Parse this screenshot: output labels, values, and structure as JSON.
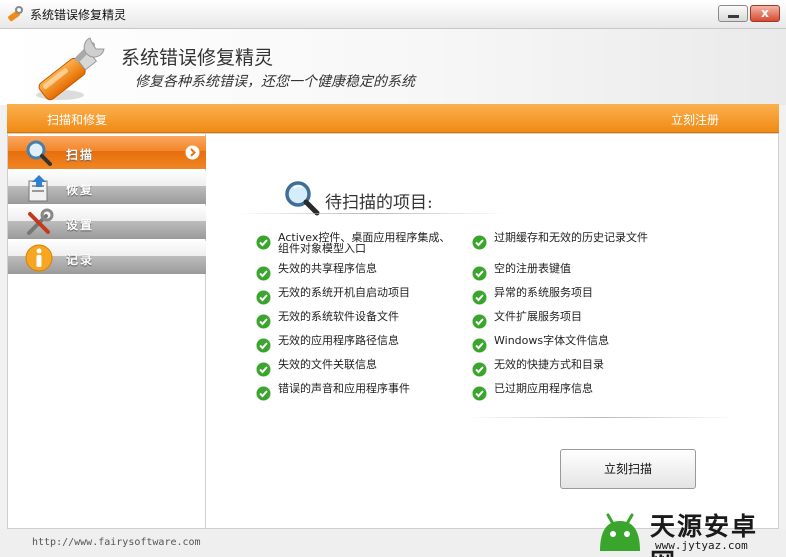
{
  "window": {
    "title": "系统错误修复精灵",
    "minimize_icon": "minimize-icon",
    "close_icon": "close-icon",
    "close_glyph": "x"
  },
  "header": {
    "title": "系统错误修复精灵",
    "subtitle": "修复各种系统错误，还您一个健康稳定的系统",
    "logo_icon": "usb-wrench-icon"
  },
  "toolbar": {
    "section_label": "扫描和修复",
    "register_link": "立刻注册"
  },
  "sidebar": {
    "items": [
      {
        "label": "扫描",
        "icon": "magnifier-icon",
        "active": true
      },
      {
        "label": "恢复",
        "icon": "restore-icon",
        "active": false
      },
      {
        "label": "设置",
        "icon": "tools-icon",
        "active": false
      },
      {
        "label": "记录",
        "icon": "info-icon",
        "active": false
      }
    ]
  },
  "main": {
    "pending_title": "待扫描的项目:",
    "left_items": [
      "Activex控件、桌面应用程序集成、组件对象模型入口",
      "失效的共享程序信息",
      "无效的系统开机自启动项目",
      "无效的系统软件设备文件",
      "无效的应用程序路径信息",
      "失效的文件关联信息",
      "错误的声音和应用程序事件"
    ],
    "right_items": [
      "过期缓存和无效的历史记录文件",
      "空的注册表键值",
      "异常的系统服务项目",
      "文件扩展服务项目",
      "Windows字体文件信息",
      "无效的快捷方式和目录",
      "已过期应用程序信息"
    ],
    "scan_button": "立刻扫描"
  },
  "status": {
    "url": "http://www.fairysoftware.com"
  },
  "watermark": {
    "name": "天源安卓网",
    "url": "www.jytyaz.com"
  },
  "colors": {
    "accent_orange": "#f08a14",
    "check_green": "#3aa52c"
  }
}
